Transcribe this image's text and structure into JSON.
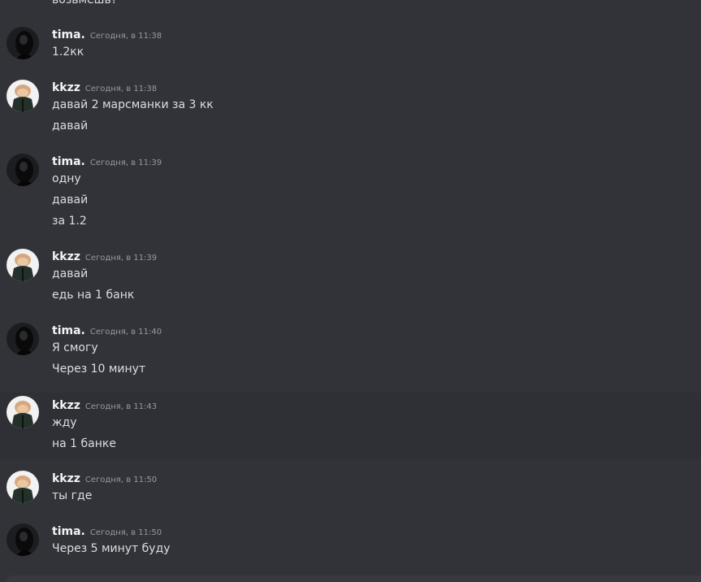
{
  "chat": {
    "top_partial_text": "возьмешь?",
    "messages": [
      {
        "user": "tima.",
        "time": "Сегодня, в 11:38",
        "lines": [
          "1.2кк"
        ]
      },
      {
        "user": "kkzz",
        "time": "Сегодня, в 11:38",
        "lines": [
          "давай 2 марсманки за 3 кк",
          "давай"
        ]
      },
      {
        "user": "tima.",
        "time": "Сегодня, в 11:39",
        "lines": [
          "одну",
          "давай",
          "за 1.2"
        ]
      },
      {
        "user": "kkzz",
        "time": "Сегодня, в 11:39",
        "lines": [
          "давай",
          "едь на 1 банк"
        ]
      },
      {
        "user": "tima.",
        "time": "Сегодня, в 11:40",
        "lines": [
          "Я смогу",
          "Через 10 минут"
        ]
      },
      {
        "user": "kkzz",
        "time": "Сегодня, в 11:43",
        "lines": [
          "жду",
          "на 1 банке"
        ]
      },
      {
        "user": "kkzz",
        "time": "Сегодня, в 11:50",
        "lines": [
          "ты где"
        ]
      },
      {
        "user": "tima.",
        "time": "Сегодня, в 11:50",
        "lines": [
          "Через 5 минут буду"
        ]
      }
    ]
  },
  "colors": {
    "background": "#313338",
    "username": "#f2f3f5",
    "message_text": "#dbdee1",
    "timestamp": "#949ba4"
  },
  "icons": {
    "tima_avatar": "dark-hooded-figure-avatar-icon",
    "kkzz_avatar": "cat-in-jacket-avatar-icon"
  }
}
